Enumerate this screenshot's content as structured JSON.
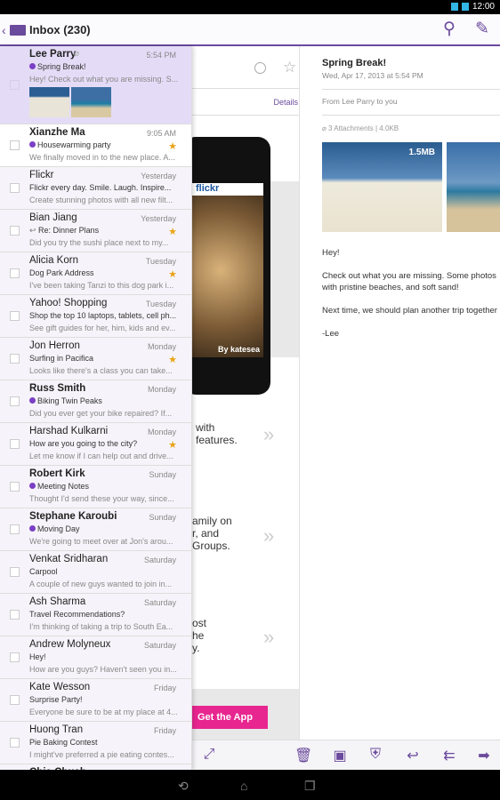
{
  "status": {
    "time": "12:00"
  },
  "header": {
    "title": "Inbox (230)",
    "icons": [
      "back-chevron-icon",
      "mail-icon",
      "search-icon",
      "compose-icon"
    ]
  },
  "colors": {
    "accent": "#6a4a9c",
    "selected": "#e4dcf7",
    "star": "#e8a317",
    "label_dot": "#7b3fc4",
    "cta": "#e8268f"
  },
  "emails": [
    {
      "from": "Lee Parry",
      "time": "5:54 PM",
      "subject": "Spring Break!",
      "snippet": "Hey! Check out what you are missing. S...",
      "unread": true,
      "dot": true,
      "star": false,
      "attachment": true,
      "selected": true
    },
    {
      "from": "Xianzhe Ma",
      "time": "9:05 AM",
      "subject": "Housewarming party",
      "snippet": "We finally moved in to the new place. A...",
      "unread": true,
      "dot": true,
      "star": true
    },
    {
      "from": "Flickr",
      "time": "Yesterday",
      "subject": "Flickr every day. Smile. Laugh. Inspire...",
      "snippet": "Create stunning photos with all new filt...",
      "unread": false,
      "dot": false,
      "star": false
    },
    {
      "from": "Bian Jiang",
      "time": "Yesterday",
      "subject": "Re: Dinner Plans",
      "snippet": "Did you try the sushi place next to my...",
      "unread": false,
      "dot": false,
      "star": true,
      "replied": true
    },
    {
      "from": "Alicia Korn",
      "time": "Tuesday",
      "subject": "Dog Park Address",
      "snippet": "I've been taking Tanzi to this dog park i...",
      "unread": false,
      "dot": false,
      "star": true
    },
    {
      "from": "Yahoo! Shopping",
      "time": "Tuesday",
      "subject": "Shop the top 10 laptops, tablets, cell ph...",
      "snippet": "See gift guides for her, him, kids and ev...",
      "unread": false,
      "dot": false,
      "star": false
    },
    {
      "from": "Jon Herron",
      "time": "Monday",
      "subject": "Surfing in Pacifica",
      "snippet": "Looks like there's a class you can take...",
      "unread": false,
      "dot": false,
      "star": true
    },
    {
      "from": "Russ Smith",
      "time": "Monday",
      "subject": "Biking Twin Peaks",
      "snippet": "Did you ever get your bike repaired? If...",
      "unread": true,
      "dot": true,
      "star": false
    },
    {
      "from": "Harshad Kulkarni",
      "time": "Monday",
      "subject": "How are you going to the city?",
      "snippet": "Let me know if I can help out and drive...",
      "unread": false,
      "dot": false,
      "star": true
    },
    {
      "from": "Robert Kirk",
      "time": "Sunday",
      "subject": "Meeting Notes",
      "snippet": "Thought I'd send these your way, since...",
      "unread": true,
      "dot": true,
      "star": false
    },
    {
      "from": "Stephane Karoubi",
      "time": "Sunday",
      "subject": "Moving Day",
      "snippet": "We're going to meet over at Jon's arou...",
      "unread": true,
      "dot": true,
      "star": false
    },
    {
      "from": "Venkat Sridharan",
      "time": "Saturday",
      "subject": "Carpool",
      "snippet": "A couple of new guys wanted to join in...",
      "unread": false,
      "dot": false,
      "star": false
    },
    {
      "from": "Ash Sharma",
      "time": "Saturday",
      "subject": "Travel Recommendations?",
      "snippet": "I'm thinking of taking a trip to South Ea...",
      "unread": false,
      "dot": false,
      "star": false
    },
    {
      "from": "Andrew Molyneux",
      "time": "Saturday",
      "subject": "Hey!",
      "snippet": "How are you guys? Haven't seen you in...",
      "unread": false,
      "dot": false,
      "star": false
    },
    {
      "from": "Kate Wesson",
      "time": "Friday",
      "subject": "Surprise Party!",
      "snippet": "Everyone be sure to be at my place at 4...",
      "unread": false,
      "dot": false,
      "star": false
    },
    {
      "from": "Huong Tran",
      "time": "Friday",
      "subject": "Pie Baking Contest",
      "snippet": "I might've preferred a pie eating contes...",
      "unread": false,
      "dot": false,
      "star": false
    },
    {
      "from": "Chia Chuah",
      "time": "",
      "subject": "",
      "snippet": "",
      "unread": true,
      "dot": false,
      "star": false
    }
  ],
  "middle": {
    "details": "Details",
    "phone_brand": "flickr",
    "photo_credit": "By katesea",
    "promo1": "with\nfeatures.",
    "promo2": "amily on\nr, and\nGroups.",
    "promo3": "ost\nhe\ny.",
    "cta": "Get the App"
  },
  "message": {
    "subject": "Spring Break!",
    "date": "Wed, Apr 17, 2013 at 5:54 PM",
    "from_line": "From Lee Parry to you",
    "attachments": "3 Attachments  |  4.0KB",
    "attachment_size": "1.5MB",
    "body": [
      "Hey!",
      "Check out what you are missing. Some photos with pristine beaches, and soft sand!",
      "Next time, we should plan another trip together",
      "-Lee"
    ]
  },
  "toolbar": [
    "expand-icon",
    "trash-icon",
    "move-folder-icon",
    "spam-icon",
    "reply-icon",
    "reply-all-icon",
    "forward-icon"
  ]
}
